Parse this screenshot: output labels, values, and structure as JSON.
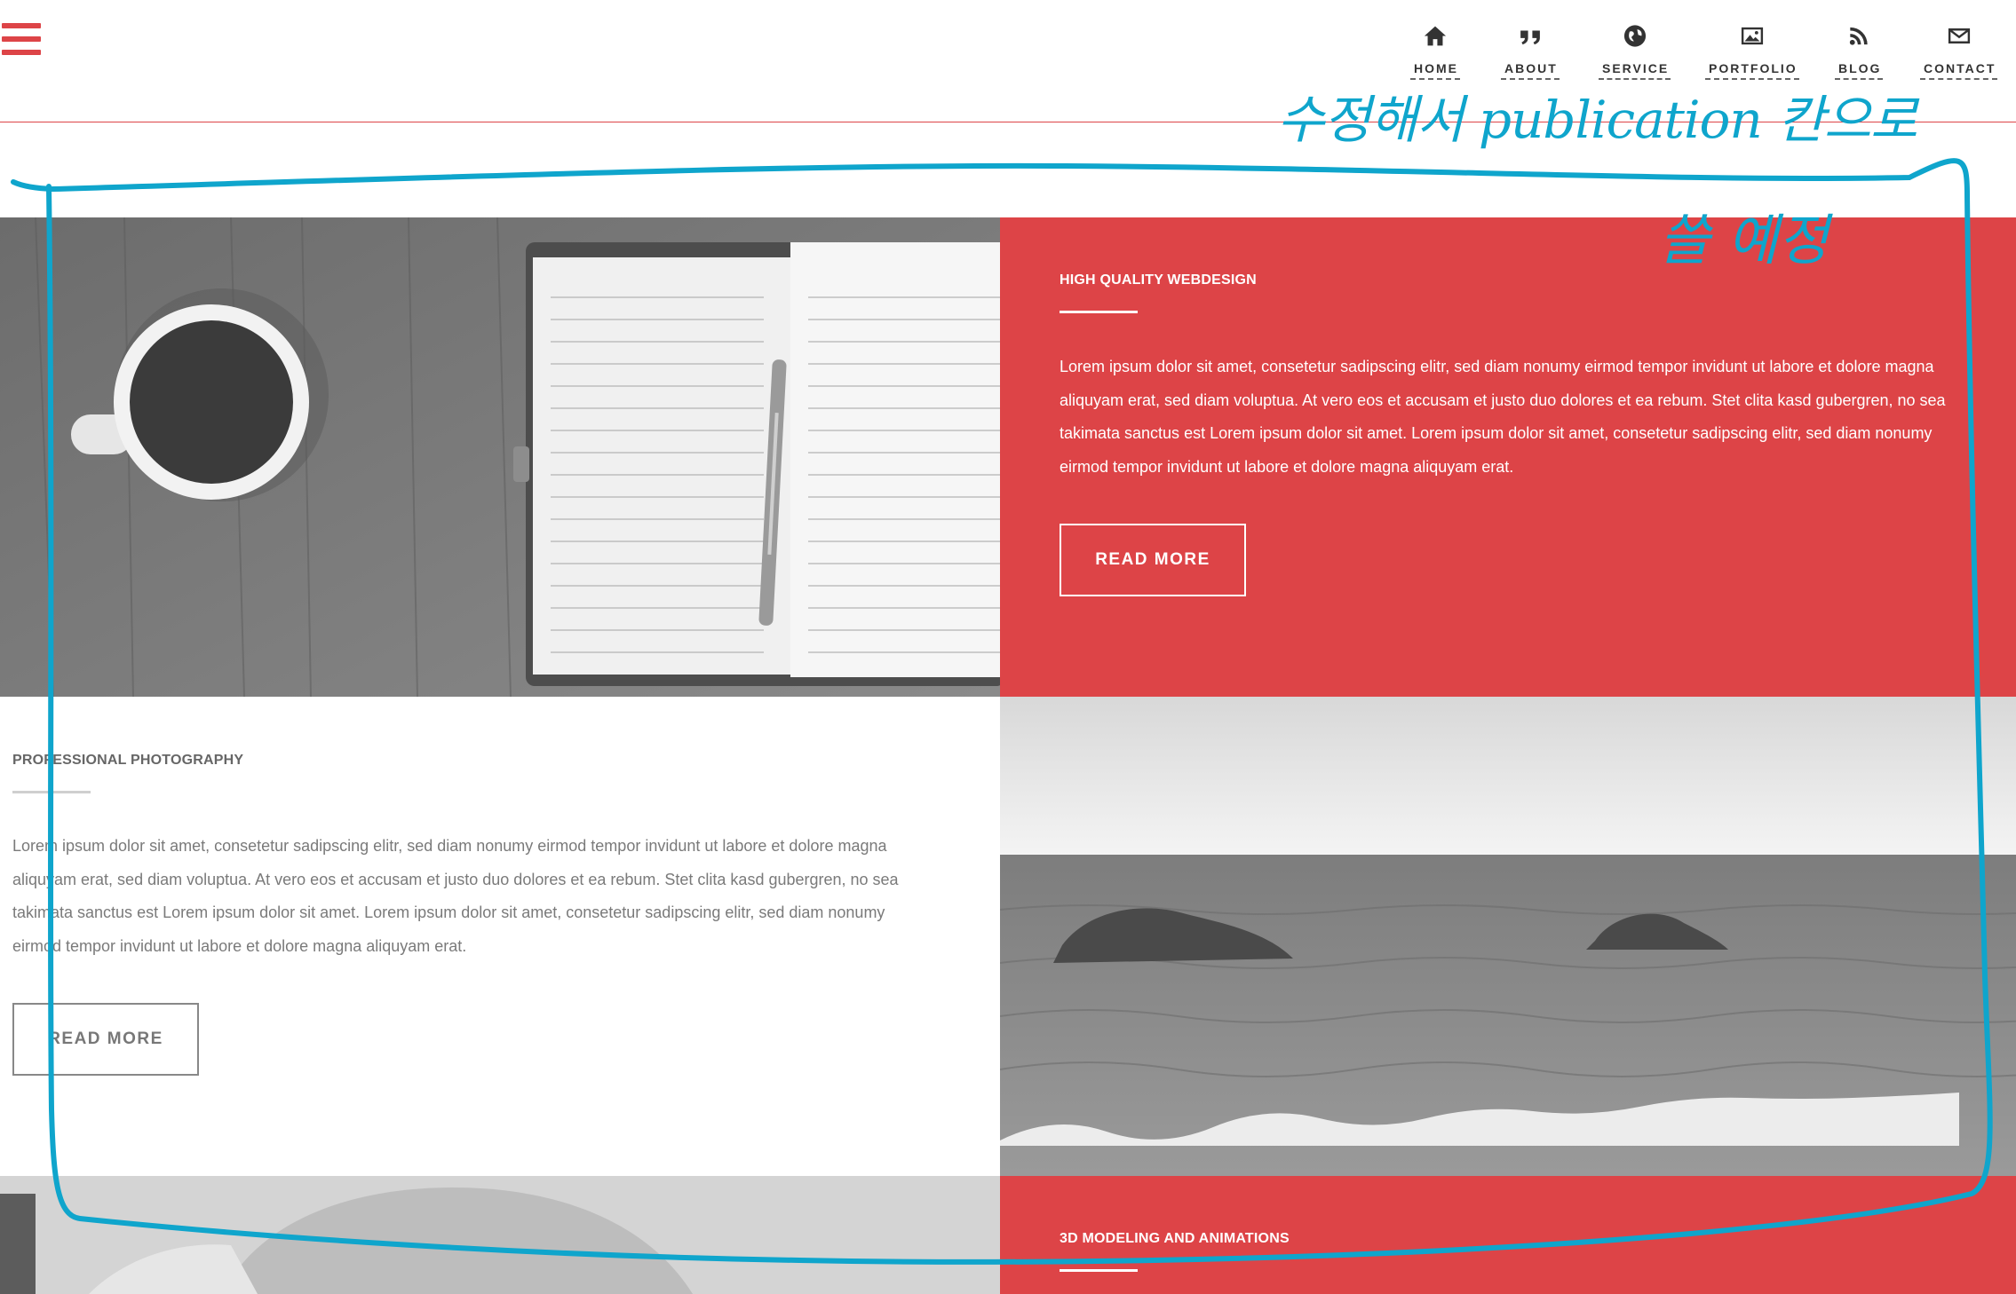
{
  "nav": {
    "items": [
      {
        "label": "HOME",
        "icon": "home-icon"
      },
      {
        "label": "ABOUT",
        "icon": "quote-icon"
      },
      {
        "label": "SERVICE",
        "icon": "globe-icon"
      },
      {
        "label": "PORTFOLIO",
        "icon": "image-icon"
      },
      {
        "label": "BLOG",
        "icon": "rss-icon"
      },
      {
        "label": "CONTACT",
        "icon": "envelope-icon"
      }
    ]
  },
  "colors": {
    "accent": "#dd4447",
    "annotation": "#0fa5cc"
  },
  "sections": [
    {
      "heading": "HIGH QUALITY WEBDESIGN",
      "text": "Lorem ipsum dolor sit amet, consetetur sadipscing elitr, sed diam nonumy eirmod tempor invidunt ut labore et dolore magna aliquyam erat, sed diam voluptua. At vero eos et accusam et justo duo dolores et ea rebum. Stet clita kasd gubergren, no sea takimata sanctus est Lorem ipsum dolor sit amet. Lorem ipsum dolor sit amet, consetetur sadipscing elitr, sed diam nonumy eirmod tempor invidunt ut labore et dolore magna aliquyam erat.",
      "button": "READ MORE"
    },
    {
      "heading": "PROFESSIONAL PHOTOGRAPHY",
      "text": "Lorem ipsum dolor sit amet, consetetur sadipscing elitr, sed diam nonumy eirmod tempor invidunt ut labore et dolore magna aliquyam erat, sed diam voluptua. At vero eos et accusam et justo duo dolores et ea rebum. Stet clita kasd gubergren, no sea takimata sanctus est Lorem ipsum dolor sit amet. Lorem ipsum dolor sit amet, consetetur sadipscing elitr, sed diam nonumy eirmod tempor invidunt ut labore et dolore magna aliquyam erat.",
      "button": "READ MORE"
    },
    {
      "heading": "3D MODELING AND ANIMATIONS"
    }
  ],
  "annotation": {
    "line1": "수정해서 publication 칸으로",
    "line2": "쓸 예정"
  }
}
